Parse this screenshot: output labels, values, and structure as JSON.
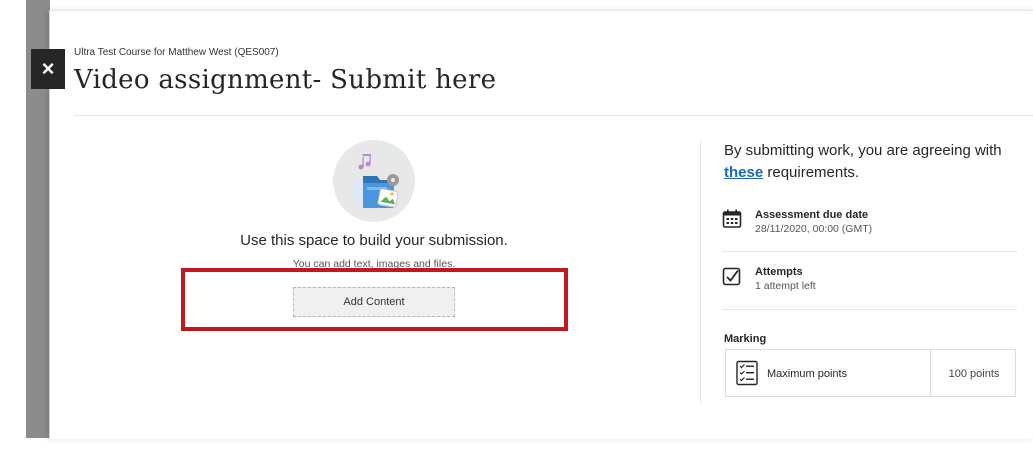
{
  "header": {
    "course_name": "Ultra Test Course for Matthew West (QES007)",
    "title": "Video assignment- Submit here",
    "close_label": "×"
  },
  "submission": {
    "title": "Use this space to build your submission.",
    "subtitle": "You can add text, images and files.",
    "add_content_label": "Add Content"
  },
  "requirements": {
    "text_before": "By submitting work, you are agreeing with ",
    "link_text": "these",
    "text_after": " requirements."
  },
  "details": {
    "due": {
      "label": "Assessment due date",
      "value": "28/11/2020, 00:00 (GMT)",
      "icon": "calendar-icon"
    },
    "attempts": {
      "label": "Attempts",
      "value": "1 attempt left",
      "icon": "checkbox-icon"
    }
  },
  "marking": {
    "heading": "Marking",
    "points_label": "Maximum points",
    "points_value": "100 points",
    "icon": "rubric-list-icon"
  },
  "colors": {
    "highlight_border": "#c0181d",
    "link": "#1e67b3",
    "close_button_bg": "#262626"
  }
}
